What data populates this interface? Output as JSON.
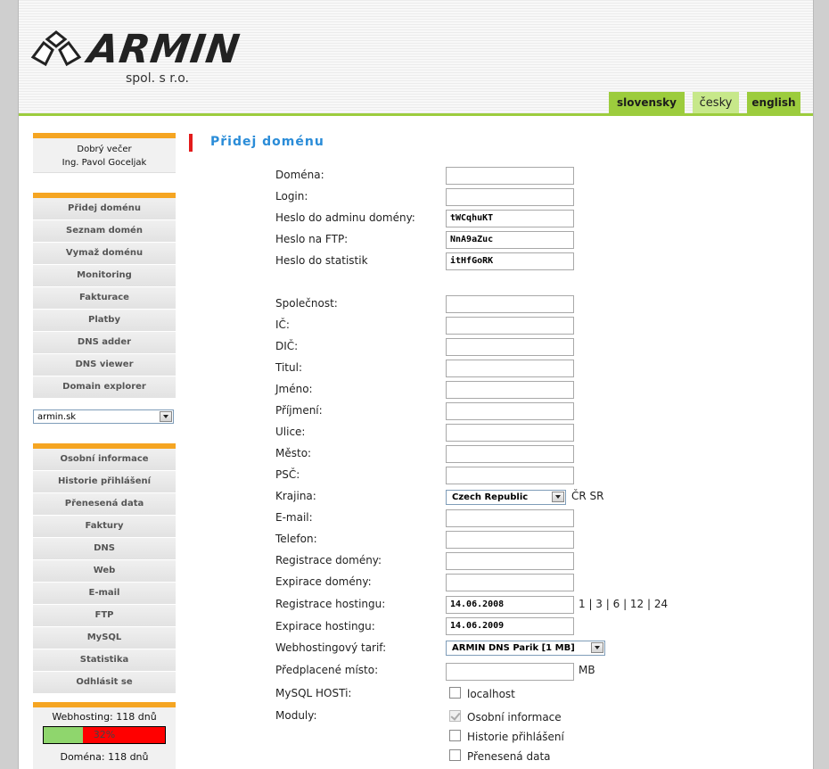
{
  "brand": {
    "name": "ARMIN",
    "subtitle": "spol. s r.o."
  },
  "languages": [
    {
      "label": "slovensky"
    },
    {
      "label": "česky"
    },
    {
      "label": "english"
    }
  ],
  "greeting": {
    "line1": "Dobrý večer",
    "line2": "Ing. Pavol Goceljak"
  },
  "menu1": [
    "Přidej doménu",
    "Seznam domén",
    "Vymaž doménu",
    "Monitoring",
    "Fakturace",
    "Platby",
    "DNS adder",
    "DNS viewer",
    "Domain explorer"
  ],
  "domain_select": {
    "value": "armin.sk"
  },
  "menu2": [
    "Osobní informace",
    "Historie přihlášení",
    "Přenesená data",
    "Faktury",
    "DNS",
    "Web",
    "E-mail",
    "FTP",
    "MySQL",
    "Statistika",
    "Odhlásit se"
  ],
  "stats": {
    "webhosting_label": "Webhosting: 118 dnů",
    "webhosting_percent_label": "32%",
    "webhosting_fraction": 0.32,
    "domain_label": "Doména: 118 dnů"
  },
  "colors": {
    "accent_green": "#9ccc3d",
    "orange": "#f5a522",
    "title_blue": "#2a8cd8",
    "title_red": "#e31b1b"
  },
  "form": {
    "title": "Přidej doménu",
    "fields": [
      {
        "label": "Doména:",
        "value": ""
      },
      {
        "label": "Login:",
        "value": ""
      },
      {
        "label": "Heslo do adminu domény:",
        "value": "tWCqhuKT"
      },
      {
        "label": "Heslo na FTP:",
        "value": "NnA9aZuc"
      },
      {
        "label": "Heslo do statistik",
        "value": "itHfGoRK"
      },
      {
        "label": "Společnost:",
        "value": ""
      },
      {
        "label": "IČ:",
        "value": ""
      },
      {
        "label": "DIČ:",
        "value": ""
      },
      {
        "label": "Titul:",
        "value": ""
      },
      {
        "label": "Jméno:",
        "value": ""
      },
      {
        "label": "Příjmení:",
        "value": ""
      },
      {
        "label": "Ulice:",
        "value": ""
      },
      {
        "label": "Město:",
        "value": ""
      },
      {
        "label": "PSČ:",
        "value": ""
      },
      {
        "label": "Krajina:",
        "value": "Czech Republic"
      },
      {
        "label": "E-mail:",
        "value": ""
      },
      {
        "label": "Telefon:",
        "value": ""
      },
      {
        "label": "Registrace domény:",
        "value": ""
      },
      {
        "label": "Expirace domény:",
        "value": ""
      },
      {
        "label": "Registrace hostingu:",
        "value": "14.06.2008"
      },
      {
        "label": "Expirace hostingu:",
        "value": "14.06.2009"
      },
      {
        "label": "Webhostingový tarif:",
        "value": "ARMIN DNS Parik [1 MB]"
      },
      {
        "label": "Předplacené místo:",
        "value": ""
      },
      {
        "label": "MySQL HOSTi:"
      },
      {
        "label": "Moduly:"
      }
    ],
    "country_shortcuts": "ČR SR",
    "period_links": "1 | 3 | 6 | 12 | 24",
    "space_unit": "MB",
    "mysql_hosts": [
      {
        "label": "localhost",
        "checked": false
      }
    ],
    "modules": [
      {
        "label": "Osobní informace",
        "checked": true
      },
      {
        "label": "Historie přihlášení",
        "checked": false
      },
      {
        "label": "Přenesená data",
        "checked": false
      }
    ]
  }
}
